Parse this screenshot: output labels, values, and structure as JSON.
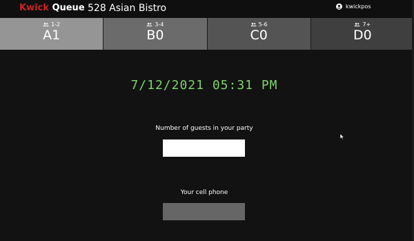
{
  "brand": {
    "word1": "Kwick",
    "word2": "Queue"
  },
  "store_name": "528 Asian Bistro",
  "user": {
    "name": "kwickpos",
    "icon": "user-circle-icon"
  },
  "tabs": [
    {
      "range": "1-2",
      "code": "A1",
      "icon": "people-icon"
    },
    {
      "range": "3-4",
      "code": "B0",
      "icon": "people-icon"
    },
    {
      "range": "5-6",
      "code": "C0",
      "icon": "people-icon"
    },
    {
      "range": "7+",
      "code": "D0",
      "icon": "people-icon"
    }
  ],
  "clock": "7/12/2021 05:31 PM",
  "form": {
    "guests_label": "Number of guests in your party",
    "guests_value": "",
    "phone_label": "Your cell phone",
    "phone_value": ""
  },
  "colors": {
    "brand_red": "#d21f1f",
    "clock_green": "#7ed36b",
    "background": "#121212",
    "tab_colors": [
      "#959595",
      "#6b6b6b",
      "#545454",
      "#3f3f3f"
    ]
  }
}
